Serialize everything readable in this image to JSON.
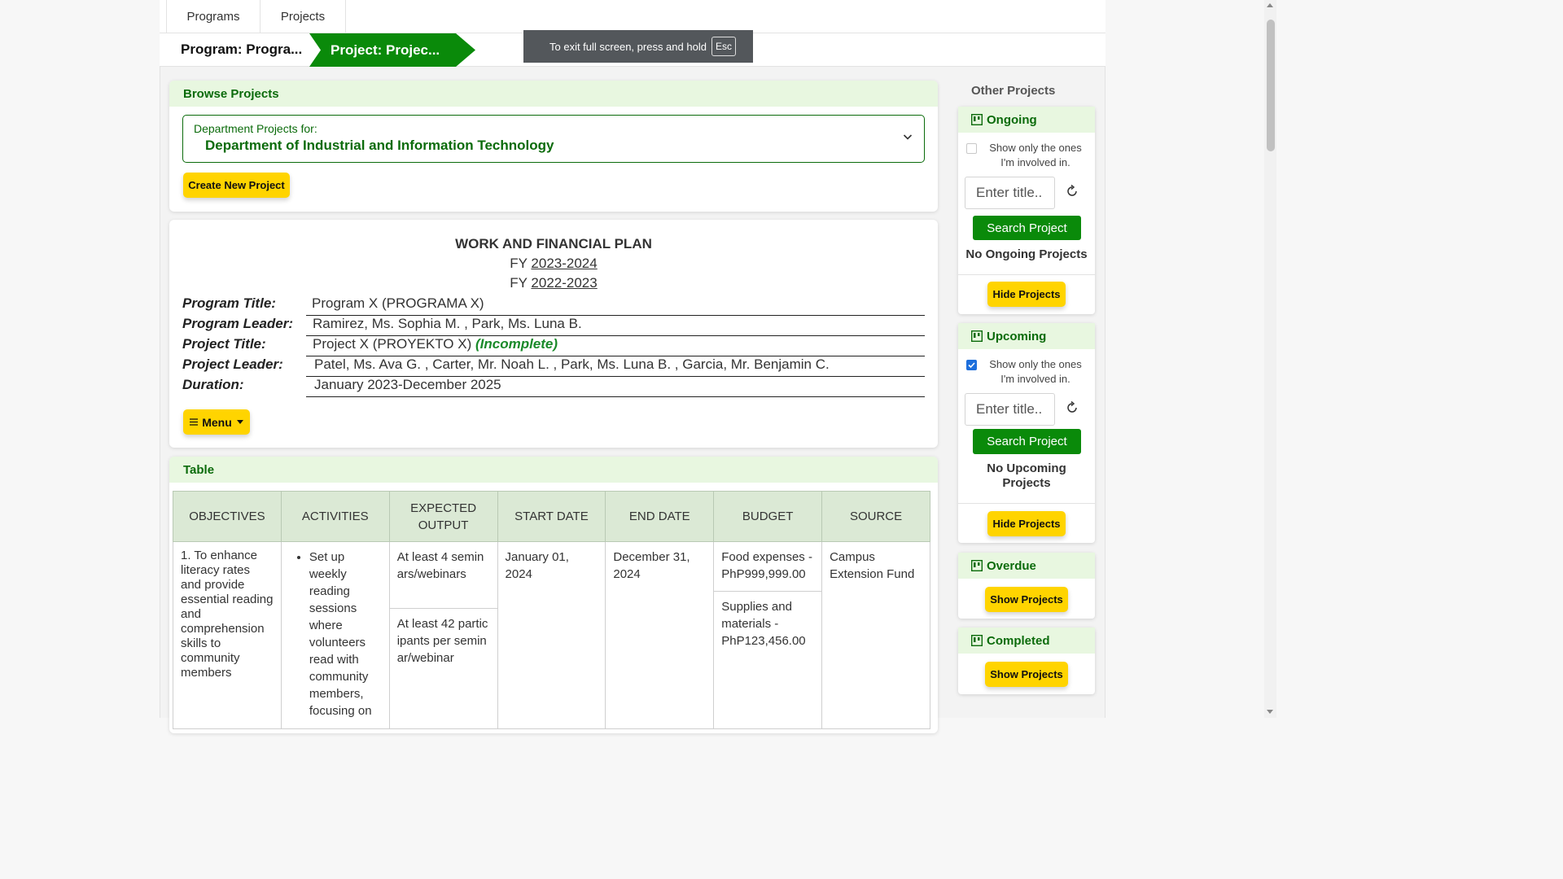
{
  "nav": {
    "tabs": [
      {
        "label": "Programs"
      },
      {
        "label": "Projects"
      }
    ]
  },
  "breadcrumb": {
    "program": "Program: Progra...",
    "project": "Project: Projec..."
  },
  "fullscreen_toast": {
    "text": "To exit full screen, press and hold",
    "key": "Esc"
  },
  "browse": {
    "header": "Browse Projects",
    "dept_label": "Department Projects for:",
    "dept_value": "Department of Industrial and Information Technology",
    "create_button": "Create New Project"
  },
  "plan": {
    "heading": "WORK AND FINANCIAL PLAN",
    "fy_prefix": "FY",
    "fy1": "2023-2024",
    "fy2": "2022-2023",
    "rows": [
      {
        "label": "Program Title:",
        "value": "Program X (PROGRAMA X)"
      },
      {
        "label": "Program Leader:",
        "value": "Ramirez, Ms. Sophia M. , Park, Ms. Luna B."
      },
      {
        "label": "Project Title:",
        "value": "Project X (PROYEKTO X)",
        "status": "(Incomplete)"
      },
      {
        "label": "Project Leader:",
        "value": "Patel, Ms. Ava G. , Carter, Mr. Noah L. , Park, Ms. Luna B. , Garcia, Mr. Benjamin C."
      },
      {
        "label": "Duration:",
        "value": "January 2023-December 2025"
      }
    ],
    "menu_button": "Menu"
  },
  "table": {
    "header": "Table",
    "columns": [
      "OBJECTIVES",
      "ACTIVITIES",
      "EXPECTED OUTPUT",
      "START DATE",
      "END DATE",
      "BUDGET",
      "SOURCE"
    ],
    "row1": {
      "objective": "1. To enhance literacy rates and provide essential reading and comprehension skills to community members",
      "activity": "Set up weekly reading sessions where volunteers read with community members, focusing on",
      "outputs": [
        "At least 4 seminars/webinars",
        "At least 42 participants per seminar/webinar"
      ],
      "start": "January 01, 2024",
      "end": "December 31, 2024",
      "budgets": [
        "Food expenses - PhP999,999.00",
        "Supplies and materials - PhP123,456.00"
      ],
      "source": "Campus Extension Fund"
    }
  },
  "sidebar": {
    "title": "Other Projects",
    "ongoing": {
      "title": "Ongoing",
      "check_label": "Show only the ones I'm involved in.",
      "checked": false,
      "placeholder": "Enter title..",
      "search_button": "Search Project",
      "empty": "No Ongoing Projects",
      "toggle_button": "Hide Projects"
    },
    "upcoming": {
      "title": "Upcoming",
      "check_label": "Show only the ones I'm involved in.",
      "checked": true,
      "placeholder": "Enter title..",
      "search_button": "Search Project",
      "empty": "No Upcoming Projects",
      "toggle_button": "Hide Projects"
    },
    "overdue": {
      "title": "Overdue",
      "toggle_button": "Show Projects"
    },
    "completed": {
      "title": "Completed",
      "toggle_button": "Show Projects"
    }
  },
  "colors": {
    "brand_green": "#0a8a0a",
    "accent_yellow": "#ffd400",
    "header_tint": "#e8f7e0"
  }
}
